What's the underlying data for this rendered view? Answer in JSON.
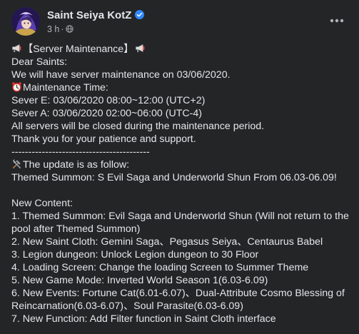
{
  "post": {
    "page_name": "Saint Seiya KotZ",
    "timestamp": "3 h",
    "separator": "·",
    "icons": {
      "verified": "verified-badge-icon",
      "audience": "globe-icon",
      "more": "more-options-icon",
      "megaphone": "megaphone-icon",
      "alarm": "alarm-clock-icon",
      "tools": "hammer-wrench-icon"
    },
    "colors": {
      "background": "#242526",
      "text": "#e4e6eb",
      "secondary_text": "#b0b3b8",
      "verified": "#2d88ff"
    },
    "lines": [
      "【Server Maintenance】",
      "Dear Saints:",
      "We will have server maintenance on 03/06/2020.",
      "Maintenance Time:",
      "Sever E: 03/06/2020 08:00~12:00 (UTC+2)",
      "Sever A: 03/06/2020 02:00~06:00 (UTC-4)",
      "All servers will be closed during the maintenance period.",
      "Thank you for your patience and support.",
      "-----------------------------------------",
      "The update is as follow:",
      "Themed Summon: S Evil Saga and Underworld Shun From 06.03-06.09!",
      "New Content:",
      "1. Themed Summon: Evil Saga and Underworld Shun (Will not return to the pool after Themed Summon)",
      "2. New Saint Cloth: Gemini Saga、Pegasus Seiya、Centaurus Babel",
      "3. Legion dungeon: Unlock Legion dungeon to 30 Floor",
      "4. Loading Screen: Change the loading Screen to Summer Theme",
      "5. New Game Mode: Inverted World Season 1(6.03-6.09)",
      "6. New Events: Fortune Cat(6.01-6.07)、Dual-Attribute Cosmo Blessing of Reincarnation(6.03-6.07)、Soul Parasite(6.03-6.09)",
      "7. New Function: Add Filter function in Saint Cloth interface"
    ]
  }
}
